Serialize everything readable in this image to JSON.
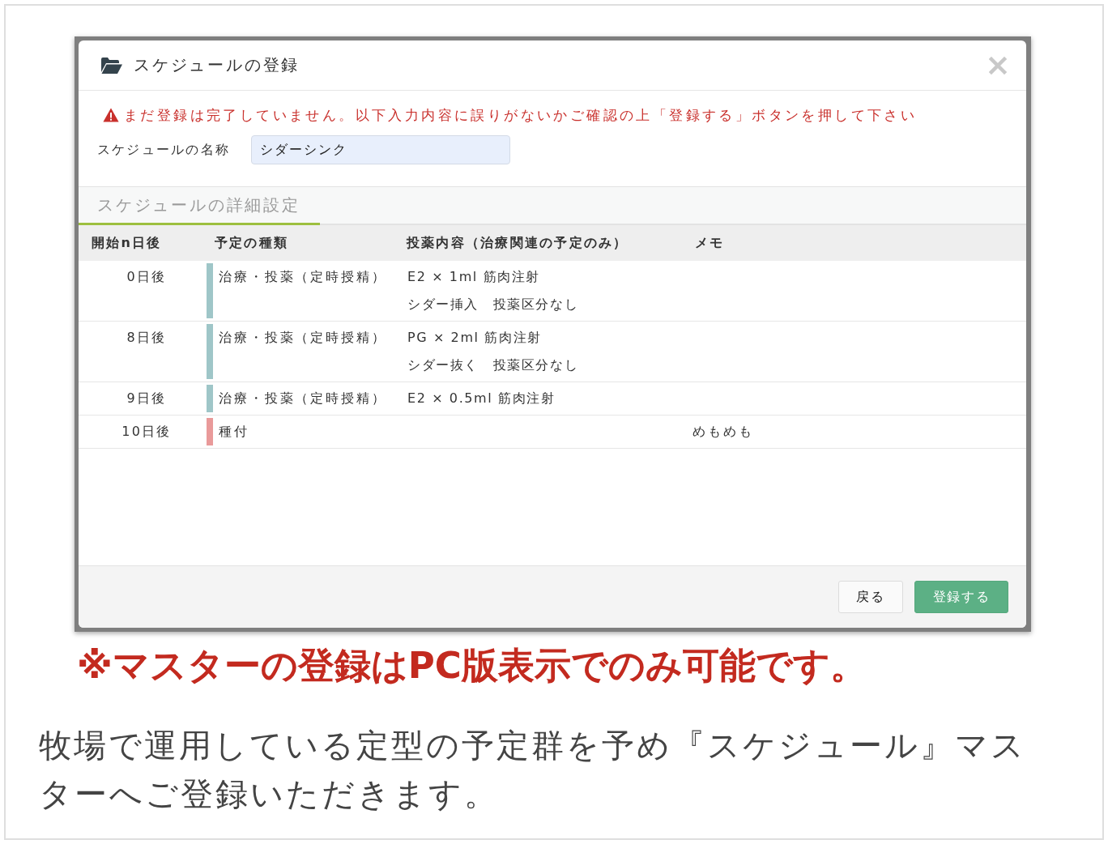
{
  "modal": {
    "title": "スケジュールの登録",
    "alert": "まだ登録は完了していません。以下入力内容に誤りがないかご確認の上「登録する」ボタンを押して下さい",
    "name_field": {
      "label": "スケジュールの名称",
      "value": "シダーシンク"
    },
    "section": {
      "title": "スケジュールの詳細設定",
      "selected": true
    },
    "table": {
      "columns": [
        "開始n日後",
        "予定の種類",
        "投薬内容（治療関連の予定のみ）",
        "メモ"
      ],
      "rows": [
        {
          "day": "0日後",
          "type": "治療・投薬（定時授精）",
          "color": "#9fc6c8",
          "details": [
            "E2 × 1ml 筋肉注射",
            "シダー挿入　投薬区分なし"
          ]
        },
        {
          "day": "8日後",
          "type": "治療・投薬（定時授精）",
          "color": "#9fc6c8",
          "details": [
            "PG × 2ml 筋肉注射",
            "シダー抜く　投薬区分なし"
          ]
        },
        {
          "day": "9日後",
          "type": "治療・投薬（定時授精）",
          "color": "#9fc6c8",
          "details": [
            "E2 × 0.5ml 筋肉注射"
          ]
        },
        {
          "day": "10日後",
          "type": "種付",
          "color": "#e99a9a",
          "memo": "めもめも"
        }
      ]
    },
    "buttons": [
      {
        "label": "戻る",
        "kind": "default"
      },
      {
        "label": "登録する",
        "kind": "primary"
      }
    ]
  },
  "notice": "※マスターの登録はPC版表示でのみ可能です。",
  "description": "牧場で運用している定型の予定群を予め『スケジュール』マスターへご登録いただきます。"
}
